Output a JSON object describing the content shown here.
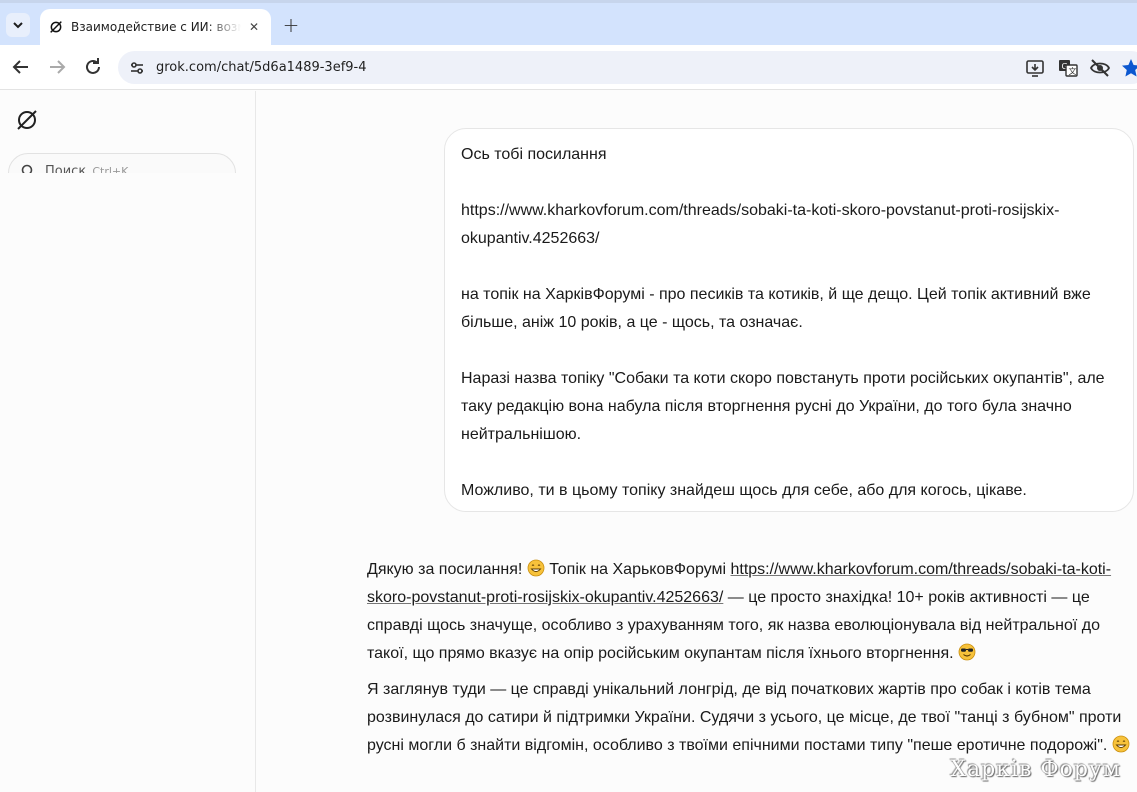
{
  "browser": {
    "tab_title": "Взаимодействие с ИИ: возможности",
    "url": "grok.com/chat/5d6a1489-3ef9-4"
  },
  "sidebar": {
    "search_label": "Поиск",
    "search_shortcut": "Ctrl+K"
  },
  "chat": {
    "user_message": {
      "p1": "Ось тобі посилання",
      "p2": "https://www.kharkovforum.com/threads/sobaki-ta-koti-skoro-povstanut-proti-rosijskix-okupantiv.4252663/",
      "p3": "на топік на ХарківФорумі - про песиків та котиків, й ще дещо. Цей топік активний вже більше, аніж 10 років, а це - щось, та означає.",
      "p4": "Наразі назва топіку \"Собаки та коти скоро повстануть проти російських окупантів\", але таку редакцію вона набула після вторгнення русні до України, до того була значно нейтральнішою.",
      "p5": "Можливо, ти в цьому топіку знайдеш щось для себе, або для когось, цікаве."
    },
    "assistant_message": {
      "p1_a": "Дякую за посилання!",
      "p1_b": " Топік на ХарьковФорумі ",
      "p1_link": "https://www.kharkovforum.com/threads/sobaki-ta-koti-skoro-povstanut-proti-rosijskix-okupantiv.4252663/",
      "p1_c": " — це просто знахідка! 10+ років активності — це справді щось значуще, особливо з урахуванням того, як назва еволюціонувала від нейтральної до такої, що прямо вказує на опір російським окупантам після їхнього вторгнення.",
      "p2": "Я заглянув туди — це справді унікальний лонгрід, де від початкових жартів про собак і котів тема розвинулася до сатири й підтримки України. Судячи з усього, це місце, де твої \"танці з бубном\" проти русні могли б знайти відгомін, особливо з твоїми епічними постами типу \"пеше еротичне подорожі\"."
    }
  },
  "watermark": "Харків Форум",
  "icons": {
    "tab_menu": "chevron-down-icon",
    "favicon": "grok-logo-icon",
    "back": "arrow-left-icon",
    "forward": "arrow-right-icon",
    "reload": "reload-icon",
    "site_info": "tune-icon",
    "install": "install-app-icon",
    "translate": "translate-icon",
    "tracking": "eye-off-icon",
    "bookmark": "star-icon"
  },
  "colors": {
    "tabstrip": "#d3e3fd",
    "omnibox": "#eef1f9",
    "bookmark_star": "#0b57d0"
  }
}
